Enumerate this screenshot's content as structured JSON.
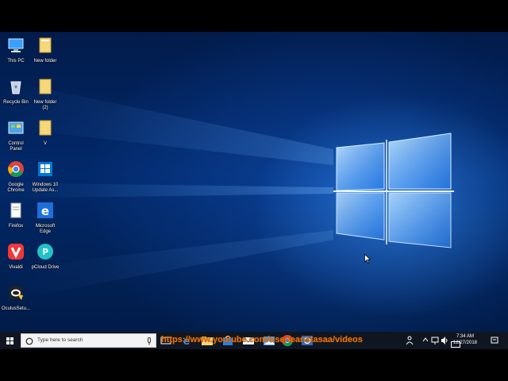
{
  "desktop": {
    "icons": [
      {
        "label": "This PC",
        "icon": "this-pc-icon"
      },
      {
        "label": "New folder",
        "icon": "folder-icon"
      },
      {
        "label": "Recycle Bin",
        "icon": "recycle-bin-icon"
      },
      {
        "label": "New folder\n(2)",
        "icon": "folder-icon"
      },
      {
        "label": "Control\nPanel",
        "icon": "control-panel-icon"
      },
      {
        "label": "V",
        "icon": "folder-icon"
      },
      {
        "label": "Google\nChrome",
        "icon": "chrome-icon"
      },
      {
        "label": "Windows 10\nUpdate As...",
        "icon": "windows-update-assistant-icon"
      },
      {
        "label": "Firefox",
        "icon": "file-icon"
      },
      {
        "label": "Microsoft\nEdge",
        "icon": "edge-icon"
      },
      {
        "label": "Vivaldi",
        "icon": "vivaldi-icon"
      },
      {
        "label": "pCloud Drive",
        "icon": "pcloud-icon"
      },
      {
        "label": "OculusSetu...",
        "icon": "oculus-setup-icon"
      }
    ]
  },
  "taskbar": {
    "search_placeholder": "Type here to search",
    "apps": [
      "task-view-icon",
      "edge-icon",
      "file-explorer-icon",
      "store-icon",
      "mail-icon",
      "photos-icon",
      "chrome-icon",
      "settings-icon"
    ],
    "overlay_url": "https://www.youtube.com/user/eanstasaa/videos",
    "clock_time": "7:34 AM",
    "clock_date": "12/27/2018",
    "tray_icons": [
      "people-icon",
      "chevron-up-icon",
      "network-icon",
      "volume-icon",
      "keyboard-icon",
      "notification-icon"
    ]
  },
  "colors": {
    "accent": "#0078d7",
    "taskbar": "#101621",
    "overlay_text": "#e8710a"
  }
}
